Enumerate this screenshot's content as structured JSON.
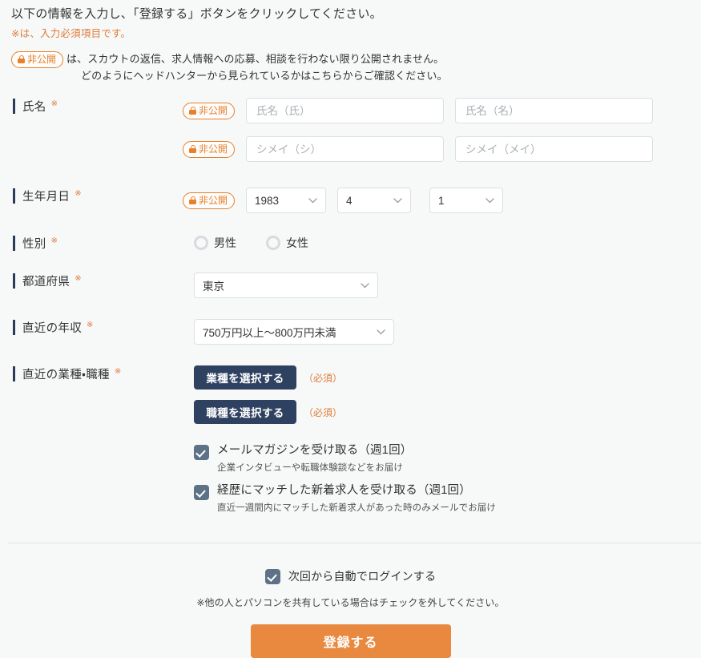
{
  "intro": {
    "line1": "以下の情報を入力し、「登録する」ボタンをクリックしてください。",
    "line2": "※は、入力必須項目です。",
    "note_line1": "は、スカウトの返信、求人情報への応募、相談を行わない限り公開されません。",
    "note_line2": "どのようにヘッドハンターから見られているかはこちらからご確認ください。"
  },
  "badge": {
    "private_label": "非公開",
    "icon": "lock-icon"
  },
  "required_mark": "※",
  "colors": {
    "accent_orange": "#e8802a",
    "submit_orange": "#e8893f",
    "navy": "#2f4160",
    "label_bar": "#2b3c56",
    "checkbox": "#5d7287",
    "page_bg": "#f7f8f8"
  },
  "fields": {
    "name": {
      "label": "氏名",
      "first_placeholder": "氏名（氏）",
      "last_placeholder": "氏名（名）",
      "kana_first_placeholder": "シメイ（シ）",
      "kana_last_placeholder": "シメイ（メイ）",
      "first_value": "",
      "last_value": "",
      "kana_first_value": "",
      "kana_last_value": ""
    },
    "birthdate": {
      "label": "生年月日",
      "year": "1983",
      "month": "4",
      "day": "1"
    },
    "gender": {
      "label": "性別",
      "options": [
        {
          "label": "男性",
          "selected": false
        },
        {
          "label": "女性",
          "selected": false
        }
      ]
    },
    "prefecture": {
      "label": "都道府県",
      "value": "東京"
    },
    "income": {
      "label": "直近の年収",
      "value": "750万円以上〜800万円未満"
    },
    "industry_job": {
      "label": "直近の業種・職種",
      "industry_button": "業種を選択する",
      "job_button": "職種を選択する",
      "required_note": "（必須）"
    }
  },
  "subscriptions": [
    {
      "title": "メールマガジンを受け取る（週1回）",
      "description": "企業インタビューや転職体験談などをお届け",
      "checked": true
    },
    {
      "title": "経歴にマッチした新着求人を受け取る（週1回）",
      "description": "直近一週間内にマッチした新着求人があった時のみメールでお届け",
      "checked": true
    }
  ],
  "footer": {
    "auto_login_label": "次回から自動でログインする",
    "auto_login_checked": true,
    "note": "※他の人とパソコンを共有している場合はチェックを外してください。",
    "submit_label": "登録する"
  },
  "icons": {
    "chevron_down": "chevron-down-icon",
    "check": "check-icon"
  }
}
